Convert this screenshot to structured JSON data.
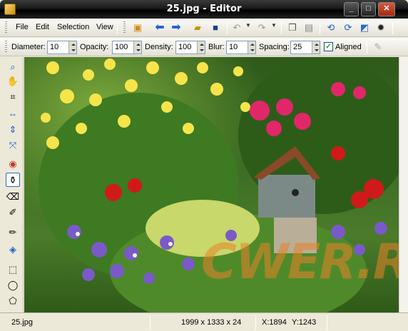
{
  "window": {
    "title": "25.jpg - Editor"
  },
  "menu": {
    "items": [
      "File",
      "Edit",
      "Selection",
      "View"
    ]
  },
  "options": {
    "diameter_label": "Diameter:",
    "diameter": "10",
    "opacity_label": "Opacity:",
    "opacity": "100",
    "density_label": "Density:",
    "density": "100",
    "blur_label": "Blur:",
    "blur": "10",
    "spacing_label": "Spacing:",
    "spacing": "25",
    "aligned_label": "Aligned",
    "aligned_checked": "✓"
  },
  "canvas": {
    "watermark": "CWER.RU"
  },
  "status": {
    "filename": "25.jpg",
    "dimensions": "1999 x 1333 x 24",
    "x": "X:1894",
    "y": "Y:1243"
  },
  "colors": {
    "accent": "#316ac5",
    "titlebar": "#000000",
    "toolbar_bg": "#ece9d8",
    "watermark": "#eb8228"
  }
}
